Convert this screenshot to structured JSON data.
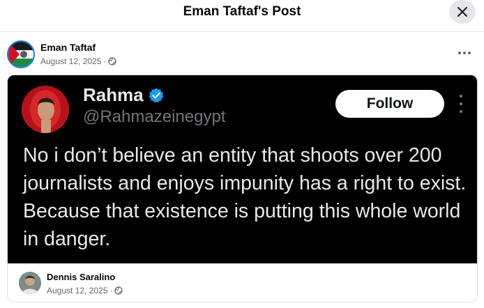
{
  "header": {
    "title": "Eman Taftaf's Post"
  },
  "post": {
    "author": "Eman Taftaf",
    "date": "August 12, 2025",
    "separator": "·"
  },
  "tweet": {
    "name": "Rahma",
    "handle": "@Rahmazeinegypt",
    "follow_label": "Follow",
    "text": "No i don’t believe an entity that shoots over 200 journalists and enjoys impunity has a right to exist. Because that existence is putting this whole world in danger."
  },
  "shared_by": {
    "author": "Dennis Saralino",
    "date": "August 12, 2025",
    "separator": "·"
  },
  "colors": {
    "accent": "#1b74e4",
    "verified": "#1d9bf0",
    "tweet_bg": "#000000",
    "meta_text": "#65676b"
  },
  "icons": {
    "close": "close-icon",
    "more": "more-horizontal-icon",
    "audience": "globe-icon",
    "verified": "verified-badge-icon"
  }
}
